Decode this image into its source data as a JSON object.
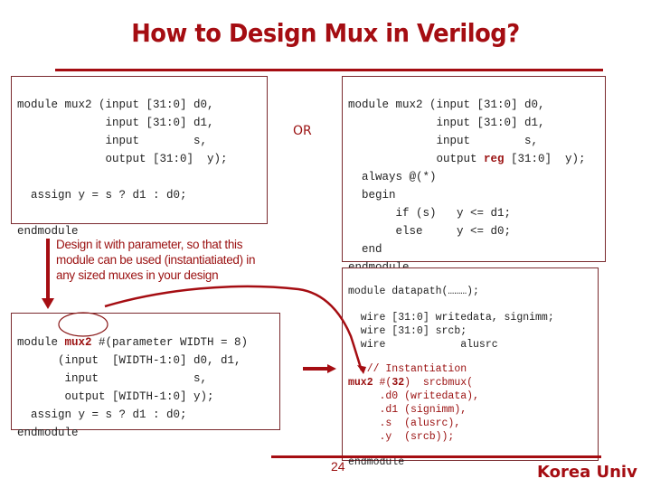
{
  "slide": {
    "title": "How to Design Mux in Verilog?",
    "or_label": "OR",
    "page_number": "24",
    "brand": "Korea Univ",
    "note": "Design it with parameter, so that this module can be used (instantiatiated) in any sized muxes in your design"
  },
  "code_left": {
    "lines": [
      "module mux2 (input [31:0] d0,",
      "             input [31:0] d1,",
      "             input        s,",
      "             output [31:0]  y);",
      "",
      "  assign y = s ? d1 : d0;",
      "",
      "endmodule"
    ]
  },
  "code_right": {
    "line0": "module mux2 (input [31:0] d0,",
    "line1": "             input [31:0] d1,",
    "line2": "             input        s,",
    "line3_pre": "             output ",
    "line3_kw": "reg",
    "line3_post": " [31:0]  y);",
    "line4": "  always @(*)",
    "line5": "  begin",
    "line6": "       if (s)   y <= d1;",
    "line7": "       else     y <= d0;",
    "line8": "  end",
    "line9": "endmodule"
  },
  "code_param": {
    "line0_pre": "module ",
    "line0_kw": "mux2",
    "line0_post": " #(parameter WIDTH = 8)",
    "line1": "      (input  [WIDTH-1:0] d0, d1,",
    "line2": "       input              s,",
    "line3": "       output [WIDTH-1:0] y);",
    "line4": "  assign y = s ? d1 : d0;",
    "line5": "endmodule"
  },
  "code_datapath": {
    "line0": "module datapath(………);",
    "line1": "  wire [31:0] writedata, signimm;",
    "line2": "  wire [31:0] srcb;",
    "line3": "  wire            alusrc",
    "line4": "   // Instantiation",
    "line5_kw": "mux2",
    "line5_mid": " #(",
    "line5_num": "32",
    "line5_post": ")  srcbmux(",
    "line6": "     .d0 (writedata),",
    "line7": "     .d1 (signimm),",
    "line8": "     .s  (alusrc),",
    "line9": "     .y  (srcb));",
    "line10": "endmodule"
  },
  "colors": {
    "accent": "#a50d12",
    "border": "#7a2a2e",
    "text": "#222222"
  }
}
